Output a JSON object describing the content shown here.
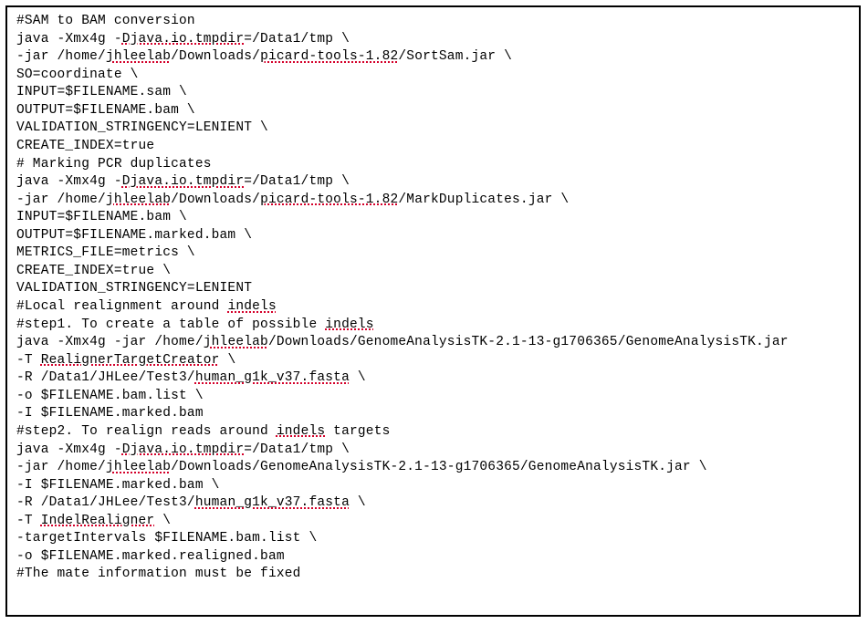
{
  "code_lines": [
    [
      {
        "t": "#SAM to BAM conversion"
      }
    ],
    [
      {
        "t": "java -Xmx4g -"
      },
      {
        "t": "Djava.io.tmpdir",
        "e": true
      },
      {
        "t": "=/Data1/tmp \\"
      }
    ],
    [
      {
        "t": "-jar /home/"
      },
      {
        "t": "jhleelab",
        "e": true
      },
      {
        "t": "/Downloads/"
      },
      {
        "t": "picard-tools-1.82",
        "e": true
      },
      {
        "t": "/SortSam.jar \\"
      }
    ],
    [
      {
        "t": "SO=coordinate \\"
      }
    ],
    [
      {
        "t": "INPUT=$FILENAME.sam \\"
      }
    ],
    [
      {
        "t": "OUTPUT=$FILENAME.bam \\"
      }
    ],
    [
      {
        "t": "VALIDATION_STRINGENCY=LENIENT \\"
      }
    ],
    [
      {
        "t": "CREATE_INDEX=true"
      }
    ],
    [
      {
        "t": ""
      }
    ],
    [
      {
        "t": "# Marking PCR duplicates"
      }
    ],
    [
      {
        "t": "java -Xmx4g -"
      },
      {
        "t": "Djava.io.tmpdir",
        "e": true
      },
      {
        "t": "=/Data1/tmp \\"
      }
    ],
    [
      {
        "t": "-jar /home/"
      },
      {
        "t": "jhleelab",
        "e": true
      },
      {
        "t": "/Downloads/"
      },
      {
        "t": "picard-tools-1.82",
        "e": true
      },
      {
        "t": "/MarkDuplicates.jar \\"
      }
    ],
    [
      {
        "t": "INPUT=$FILENAME.bam \\"
      }
    ],
    [
      {
        "t": "OUTPUT=$FILENAME.marked.bam \\"
      }
    ],
    [
      {
        "t": "METRICS_FILE=metrics \\"
      }
    ],
    [
      {
        "t": "CREATE_INDEX=true \\"
      }
    ],
    [
      {
        "t": "VALIDATION_STRINGENCY=LENIENT"
      }
    ],
    [
      {
        "t": ""
      }
    ],
    [
      {
        "t": "#Local realignment around "
      },
      {
        "t": "indels",
        "e": true
      }
    ],
    [
      {
        "t": "#step1. To create a table of possible "
      },
      {
        "t": "indels",
        "e": true
      }
    ],
    [
      {
        "t": "java -Xmx4g -jar /home/"
      },
      {
        "t": "jhleelab",
        "e": true
      },
      {
        "t": "/Downloads/GenomeAnalysisTK-2.1-13-g1706365/GenomeAnalysisTK.jar"
      }
    ],
    [
      {
        "t": "-T "
      },
      {
        "t": "RealignerTargetCreator",
        "e": true
      },
      {
        "t": " \\"
      }
    ],
    [
      {
        "t": "-R /Data1/JHLee/Test3/"
      },
      {
        "t": "human_g1k_v37.fasta",
        "e": true
      },
      {
        "t": " \\"
      }
    ],
    [
      {
        "t": "-o $FILENAME.bam.list \\"
      }
    ],
    [
      {
        "t": "-I $FILENAME.marked.bam"
      }
    ],
    [
      {
        "t": ""
      }
    ],
    [
      {
        "t": "#step2. To realign reads around "
      },
      {
        "t": "indels",
        "e": true
      },
      {
        "t": " targets"
      }
    ],
    [
      {
        "t": "java -Xmx4g -"
      },
      {
        "t": "Djava.io.tmpdir",
        "e": true
      },
      {
        "t": "=/Data1/tmp \\"
      }
    ],
    [
      {
        "t": "-jar /home/"
      },
      {
        "t": "jhleelab",
        "e": true
      },
      {
        "t": "/Downloads/GenomeAnalysisTK-2.1-13-g1706365/GenomeAnalysisTK.jar \\"
      }
    ],
    [
      {
        "t": "-I $FILENAME.marked.bam \\"
      }
    ],
    [
      {
        "t": "-R /Data1/JHLee/Test3/"
      },
      {
        "t": "human_g1k_v37.fasta",
        "e": true
      },
      {
        "t": " \\"
      }
    ],
    [
      {
        "t": "-T "
      },
      {
        "t": "IndelRealigner",
        "e": true
      },
      {
        "t": " \\"
      }
    ],
    [
      {
        "t": "-targetIntervals $FILENAME.bam.list \\"
      }
    ],
    [
      {
        "t": "-o $FILENAME.marked.realigned.bam"
      }
    ],
    [
      {
        "t": ""
      }
    ],
    [
      {
        "t": "#The mate information must be fixed"
      }
    ]
  ]
}
